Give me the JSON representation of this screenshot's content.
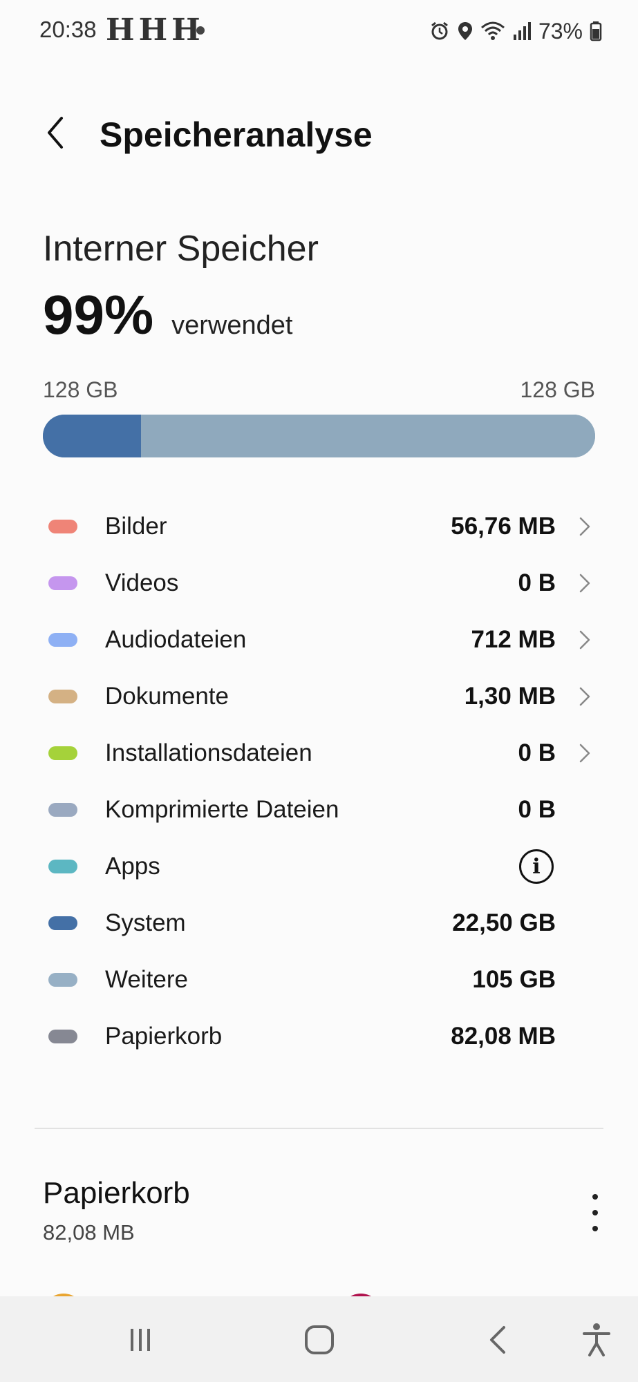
{
  "status_bar": {
    "time": "20:38",
    "notification_glyphs": "HHH",
    "battery_percent": "73%",
    "icons": [
      "alarm-icon",
      "location-icon",
      "wifi-icon",
      "signal-icon",
      "battery-icon"
    ]
  },
  "app_bar": {
    "title": "Speicheranalyse",
    "back_icon": "back-arrow-icon"
  },
  "storage": {
    "heading": "Interner Speicher",
    "percent_used": "99%",
    "used_word": "verwendet",
    "used_capacity": "128 GB",
    "total_capacity": "128 GB",
    "bar_segments": [
      {
        "name": "System",
        "fraction": 0.178,
        "color": "#4470a6"
      },
      {
        "name": "Weitere",
        "fraction": 0.822,
        "color": "#8fa9bd"
      }
    ]
  },
  "categories": [
    {
      "label": "Bilder",
      "value": "56,76 MB",
      "color": "#ef8477",
      "chevron": true
    },
    {
      "label": "Videos",
      "value": "0 B",
      "color": "#c596ee",
      "chevron": true
    },
    {
      "label": "Audiodateien",
      "value": "712 MB",
      "color": "#8eb0f4",
      "chevron": true
    },
    {
      "label": "Dokumente",
      "value": "1,30 MB",
      "color": "#d4b184",
      "chevron": true
    },
    {
      "label": "Installationsdateien",
      "value": "0 B",
      "color": "#a5d23a",
      "chevron": true
    },
    {
      "label": "Komprimierte Dateien",
      "value": "0 B",
      "color": "#9aa9c0",
      "chevron": false
    },
    {
      "label": "Apps",
      "value": "",
      "color": "#5cb7c2",
      "chevron": false,
      "info": true
    },
    {
      "label": "System",
      "value": "22,50 GB",
      "color": "#4470a6",
      "chevron": false
    },
    {
      "label": "Weitere",
      "value": "105 GB",
      "color": "#97b0c5",
      "chevron": false
    },
    {
      "label": "Papierkorb",
      "value": "82,08 MB",
      "color": "#868893",
      "chevron": false
    }
  ],
  "trash": {
    "title": "Papierkorb",
    "size": "82,08 MB",
    "menu_icon": "more-vert-icon",
    "thumb_colors": [
      "#e9a531",
      "#b0124d"
    ]
  },
  "nav_bar": {
    "buttons": [
      "recent-apps-icon",
      "home-icon",
      "back-icon",
      "accessibility-icon"
    ]
  }
}
